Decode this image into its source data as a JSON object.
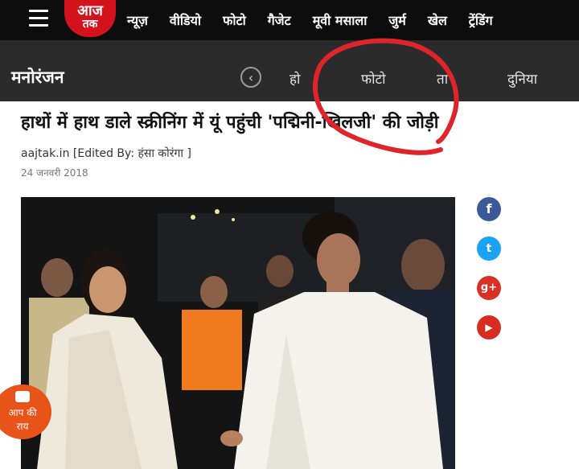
{
  "header": {
    "logo": {
      "line1": "आज",
      "line2": "तक"
    },
    "nav": [
      "न्यूज़",
      "वीडियो",
      "फोटो",
      "गैजेट",
      "मूवी मसाला",
      "जुर्म",
      "खेल",
      "ट्रेंडिंग"
    ]
  },
  "section": {
    "title": "मनोरंजन",
    "subnav": [
      {
        "label": "हो"
      },
      {
        "label": "फोटो"
      },
      {
        "label": "ता"
      },
      {
        "label": "दुनिया"
      }
    ]
  },
  "article": {
    "headline": "हाथों में हाथ डाले स्क्रीनिंग में यूं पहुंची 'पद्मिनी-खिलजी' की जोड़ी",
    "byline": "aajtak.in [Edited By: हंसा कोरंगा ]",
    "date": "24 जनवरी 2018"
  },
  "social": [
    {
      "name": "facebook",
      "glyph": "f",
      "color": "#3b5998"
    },
    {
      "name": "twitter",
      "glyph": "t",
      "color": "#1da1f2"
    },
    {
      "name": "google-plus",
      "glyph": "g+",
      "color": "#d93025"
    },
    {
      "name": "youtube",
      "glyph": "▶",
      "color": "#d62d20"
    }
  ],
  "feedback": {
    "label_line1": "आप की",
    "label_line2": "राय"
  },
  "annotation": {
    "color": "#e0242c"
  }
}
